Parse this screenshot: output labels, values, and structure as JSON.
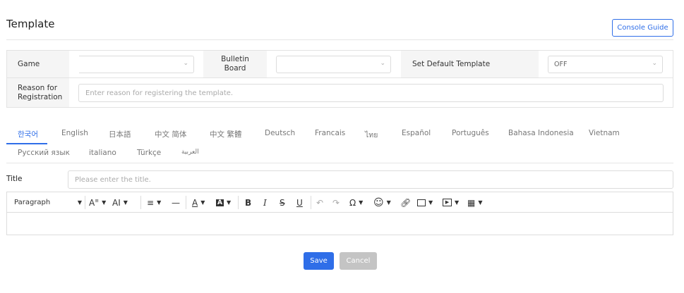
{
  "header": {
    "title": "Template",
    "console_guide_label": "Console Guide"
  },
  "form": {
    "game_label": "Game",
    "game_value": "",
    "bulletin_label": "Bulletin\nBoard",
    "bulletin_value": "",
    "default_template_label": "Set Default Template",
    "default_template_value": "OFF",
    "reason_label": "Reason for\nRegistration",
    "reason_placeholder": "Enter reason for registering the template."
  },
  "languages": [
    "한국어",
    "English",
    "日本語",
    "中文 简体",
    "中文 繁體",
    "Deutsch",
    "Francais",
    "ไทย",
    "Español",
    "Português",
    "Bahasa Indonesia",
    "Vietnam",
    "Русский язык",
    "italiano",
    "Türkçe",
    "العربية"
  ],
  "active_language_index": 0,
  "title_field": {
    "label": "Title",
    "placeholder": "Please enter the title."
  },
  "editor": {
    "paragraph_label": "Paragraph",
    "tools": [
      "font-size-icon",
      "text-height-icon",
      "align-icon",
      "horizontal-line-icon",
      "font-color-icon",
      "background-color-icon",
      "bold-icon",
      "italic-icon",
      "strikethrough-icon",
      "underline-icon",
      "undo-icon",
      "redo-icon",
      "special-character-icon",
      "emoji-icon",
      "link-icon",
      "image-icon",
      "media-icon",
      "table-icon"
    ]
  },
  "actions": {
    "save_label": "Save",
    "cancel_label": "Cancel"
  },
  "colors": {
    "accent": "#2f6ee8",
    "cancel": "#c4c4c4",
    "label_bg": "#f5f5f5"
  }
}
